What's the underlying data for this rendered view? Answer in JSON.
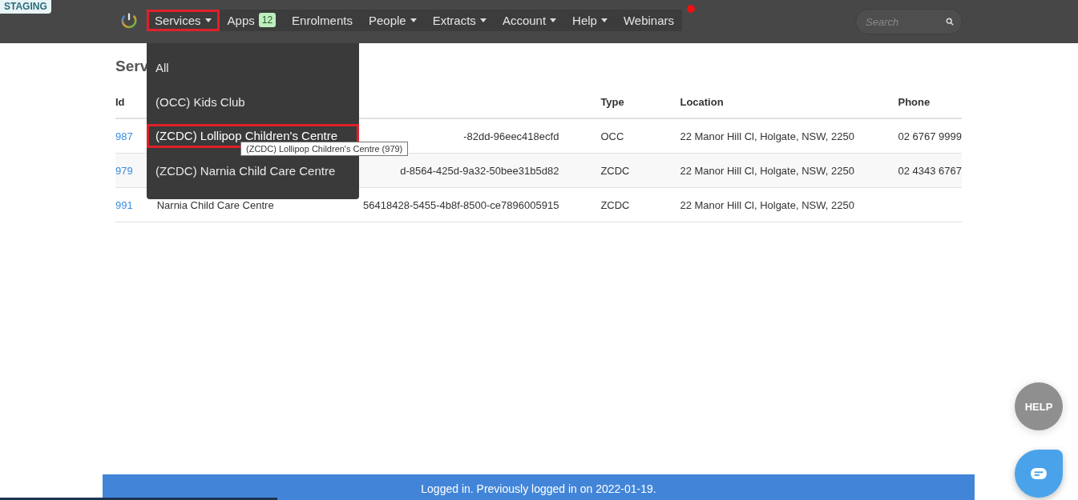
{
  "environment_badge": "STAGING",
  "nav": {
    "items": [
      {
        "label": "Services",
        "caret": true,
        "selected": true
      },
      {
        "label": "Apps",
        "badge": "12",
        "caret": false,
        "selected": false
      },
      {
        "label": "Enrolments",
        "caret": false,
        "selected": false
      },
      {
        "label": "People",
        "caret": true,
        "selected": false
      },
      {
        "label": "Extracts",
        "caret": true,
        "selected": false
      },
      {
        "label": "Account",
        "caret": true,
        "selected": false
      },
      {
        "label": "Help",
        "caret": true,
        "selected": false
      },
      {
        "label": "Webinars",
        "caret": false,
        "selected": false
      }
    ],
    "notification": true,
    "search": {
      "placeholder": "Search"
    }
  },
  "dropdown": {
    "items": [
      {
        "label": "All",
        "selected": false
      },
      {
        "label": "(OCC) Kids Club",
        "selected": false
      },
      {
        "label": "(ZCDC) Lollipop Children's Centre",
        "selected": true
      },
      {
        "label": "(ZCDC) Narnia Child Care Centre",
        "selected": false
      }
    ],
    "tooltip": "(ZCDC) Lollipop Children's Centre (979)"
  },
  "page_title": "Serv",
  "table": {
    "columns": [
      "Id",
      "Type",
      "Location",
      "Phone"
    ],
    "rows": [
      {
        "id": "987",
        "uid": "-82dd-96eec418ecfd",
        "type": "OCC",
        "location": "22 Manor Hill Cl, Holgate, NSW, 2250",
        "phone": "02 6767 9999"
      },
      {
        "id": "979",
        "uid": "d-8564-425d-9a32-50bee31b5d82",
        "type": "ZCDC",
        "location": "22 Manor Hill Cl, Holgate, NSW, 2250",
        "phone": "02 4343 6767"
      },
      {
        "id": "991",
        "name": "Narnia Child Care Centre",
        "uid": "56418428-5455-4b8f-8500-ce7896005915",
        "type": "ZCDC",
        "location": "22 Manor Hill Cl, Holgate, NSW, 2250"
      }
    ]
  },
  "footer": "Logged in. Previously logged in on 2022-01-19.",
  "help_button": "HELP"
}
